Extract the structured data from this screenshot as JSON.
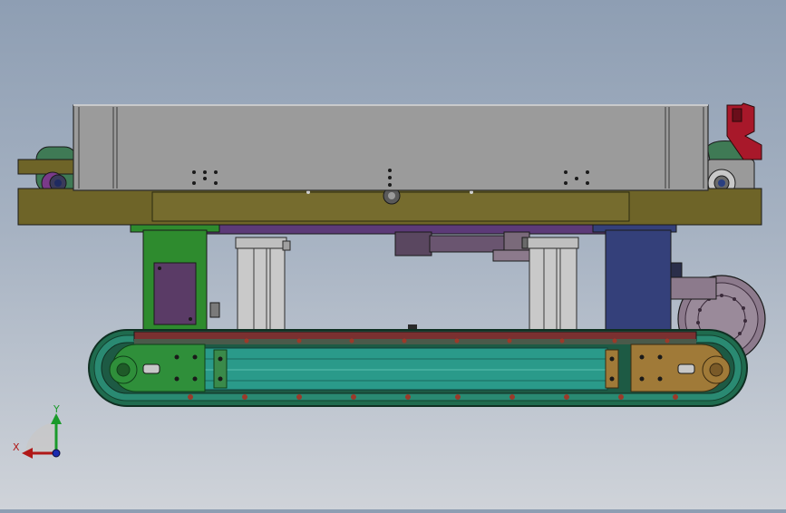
{
  "view": {
    "axes": {
      "y_label": "Y",
      "x_label": "X"
    },
    "colors": {
      "background_top": "#8e9eb3",
      "background_bottom": "#cfd3d9",
      "enclosure": "#9b9b9b",
      "base_plate": "#6e6428",
      "left_column": "#2e8b2e",
      "right_column": "#34407a",
      "cylinder": "#bfbfbf",
      "motor": "#5a4760",
      "track_rail": "#2a9a8a",
      "track_belt": "#1f6b4e",
      "left_end_plate": "#2f8f3a",
      "right_end_plate": "#a07a38",
      "sprocket": "#8c7a8c",
      "red_bracket": "#a8182a"
    },
    "icons": [
      "axis-triad-icon"
    ]
  }
}
